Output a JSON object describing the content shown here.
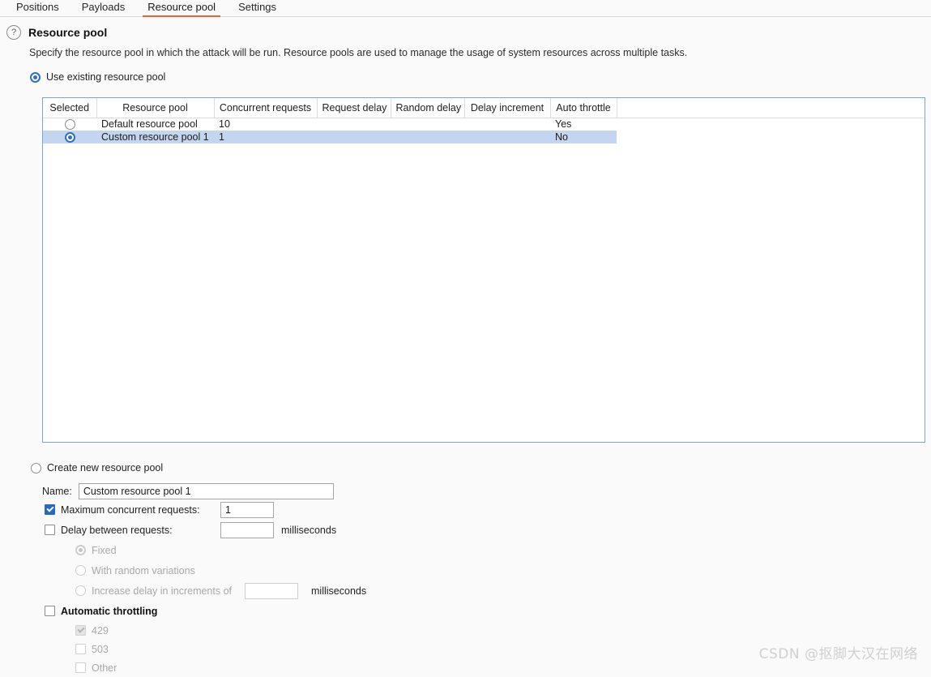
{
  "tabs": [
    {
      "label": "Positions",
      "active": false
    },
    {
      "label": "Payloads",
      "active": false
    },
    {
      "label": "Resource pool",
      "active": true
    },
    {
      "label": "Settings",
      "active": false
    }
  ],
  "header": {
    "help_icon": "help-circle-icon",
    "title": "Resource pool",
    "description": "Specify the resource pool in which the attack will be run. Resource pools are used to manage the usage of system resources across multiple tasks."
  },
  "mode": {
    "use_existing_label": "Use existing resource pool",
    "use_existing_selected": true,
    "create_new_label": "Create new resource pool",
    "create_new_selected": false
  },
  "table": {
    "columns": [
      "Selected",
      "Resource pool",
      "Concurrent requests",
      "Request delay",
      "Random delay",
      "Delay increment",
      "Auto throttle"
    ],
    "rows": [
      {
        "selected": false,
        "resource_pool": "Default resource pool",
        "concurrent_requests": "10",
        "request_delay": "",
        "random_delay": "",
        "delay_increment": "",
        "auto_throttle": "Yes"
      },
      {
        "selected": true,
        "resource_pool": "Custom resource pool 1",
        "concurrent_requests": "1",
        "request_delay": "",
        "random_delay": "",
        "delay_increment": "",
        "auto_throttle": "No"
      }
    ]
  },
  "form": {
    "name_label": "Name:",
    "name_value": "Custom resource pool 1",
    "name_placeholder": "",
    "max_concurrent": {
      "label": "Maximum concurrent requests:",
      "checked": true,
      "value": "1"
    },
    "delay_between": {
      "label": "Delay between requests:",
      "checked": false,
      "value": "",
      "unit": "milliseconds"
    },
    "delay_modes": [
      {
        "label": "Fixed",
        "selected": true,
        "disabled": true
      },
      {
        "label": "With random variations",
        "selected": false,
        "disabled": true
      }
    ],
    "increment": {
      "label": "Increase delay in increments of",
      "selected": false,
      "disabled": true,
      "value": "",
      "unit": "milliseconds"
    },
    "throttling": {
      "label": "Automatic throttling",
      "checked": false,
      "options": [
        {
          "label": "429",
          "checked": true,
          "disabled": true
        },
        {
          "label": "503",
          "checked": false,
          "disabled": true
        },
        {
          "label": "Other",
          "checked": false,
          "disabled": true
        }
      ]
    }
  },
  "watermark": "CSDN @抠脚大汉在网络",
  "colors": {
    "accent": "#e8643c",
    "selection": "#c3d5ef",
    "control_blue": "#2767c8",
    "table_border": "#7ba3d4"
  }
}
